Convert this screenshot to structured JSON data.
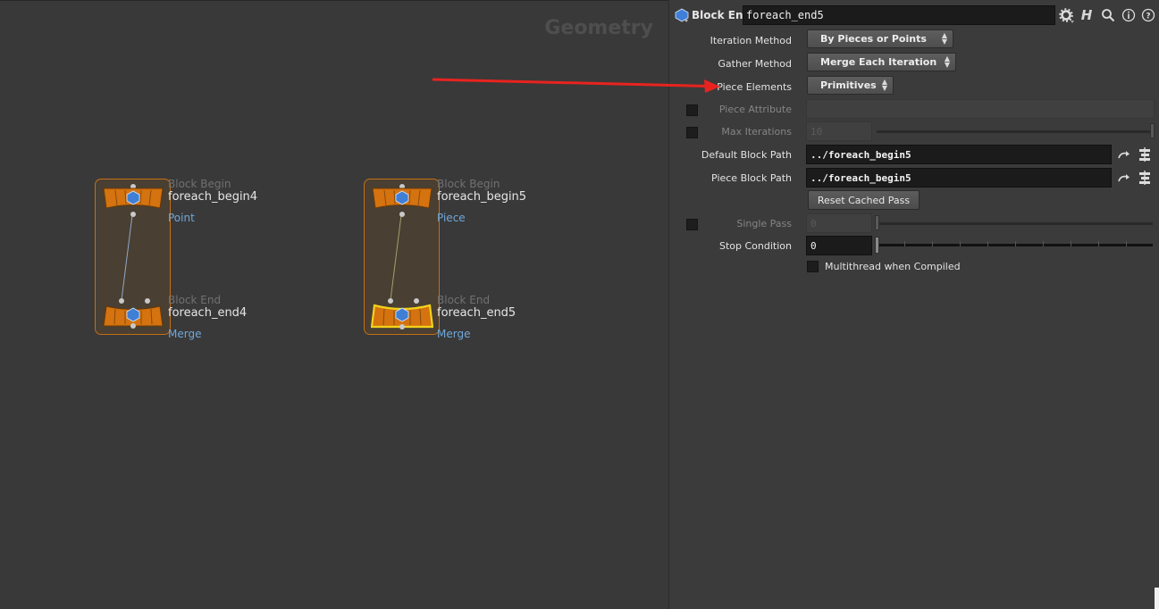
{
  "network": {
    "context_label": "Geometry",
    "blocks": [
      {
        "begin": {
          "type": "Block Begin",
          "name": "foreach_begin4",
          "sub": "Point"
        },
        "end": {
          "type": "Block End",
          "name": "foreach_end4",
          "sub": "Merge"
        },
        "wire_color": "#8fa7c7",
        "selected": false
      },
      {
        "begin": {
          "type": "Block Begin",
          "name": "foreach_begin5",
          "sub": "Piece"
        },
        "end": {
          "type": "Block End",
          "name": "foreach_end5",
          "sub": "Merge"
        },
        "wire_color": "#c9d49a",
        "selected": true
      }
    ]
  },
  "params": {
    "header": {
      "node_type": "Block End",
      "node_name": "foreach_end5",
      "icons": [
        "gear-icon",
        "houdini-help-icon",
        "search-icon",
        "info-icon",
        "help-icon"
      ]
    },
    "iteration_method": {
      "label": "Iteration Method",
      "value": "By Pieces or Points"
    },
    "gather_method": {
      "label": "Gather Method",
      "value": "Merge Each Iteration"
    },
    "piece_elements": {
      "label": "Piece Elements",
      "value": "Primitives"
    },
    "piece_attribute": {
      "label": "Piece Attribute",
      "value": "",
      "enabled": false
    },
    "max_iterations": {
      "label": "Max Iterations",
      "value": "10",
      "enabled": false
    },
    "default_block_path": {
      "label": "Default Block Path",
      "value": "../foreach_begin5"
    },
    "piece_block_path": {
      "label": "Piece Block Path",
      "value": "../foreach_begin5"
    },
    "reset_cached_pass": {
      "label": "Reset Cached Pass"
    },
    "single_pass": {
      "label": "Single Pass",
      "value": "0",
      "enabled": false
    },
    "stop_condition": {
      "label": "Stop Condition",
      "value": "0"
    },
    "multithread": {
      "label": "Multithread when Compiled",
      "checked": false
    }
  },
  "colors": {
    "annotation_arrow": "#e8231f",
    "node_orange": "#d4730f",
    "selected_outline": "#f2d21b",
    "frame_orange": "#c56f16"
  }
}
